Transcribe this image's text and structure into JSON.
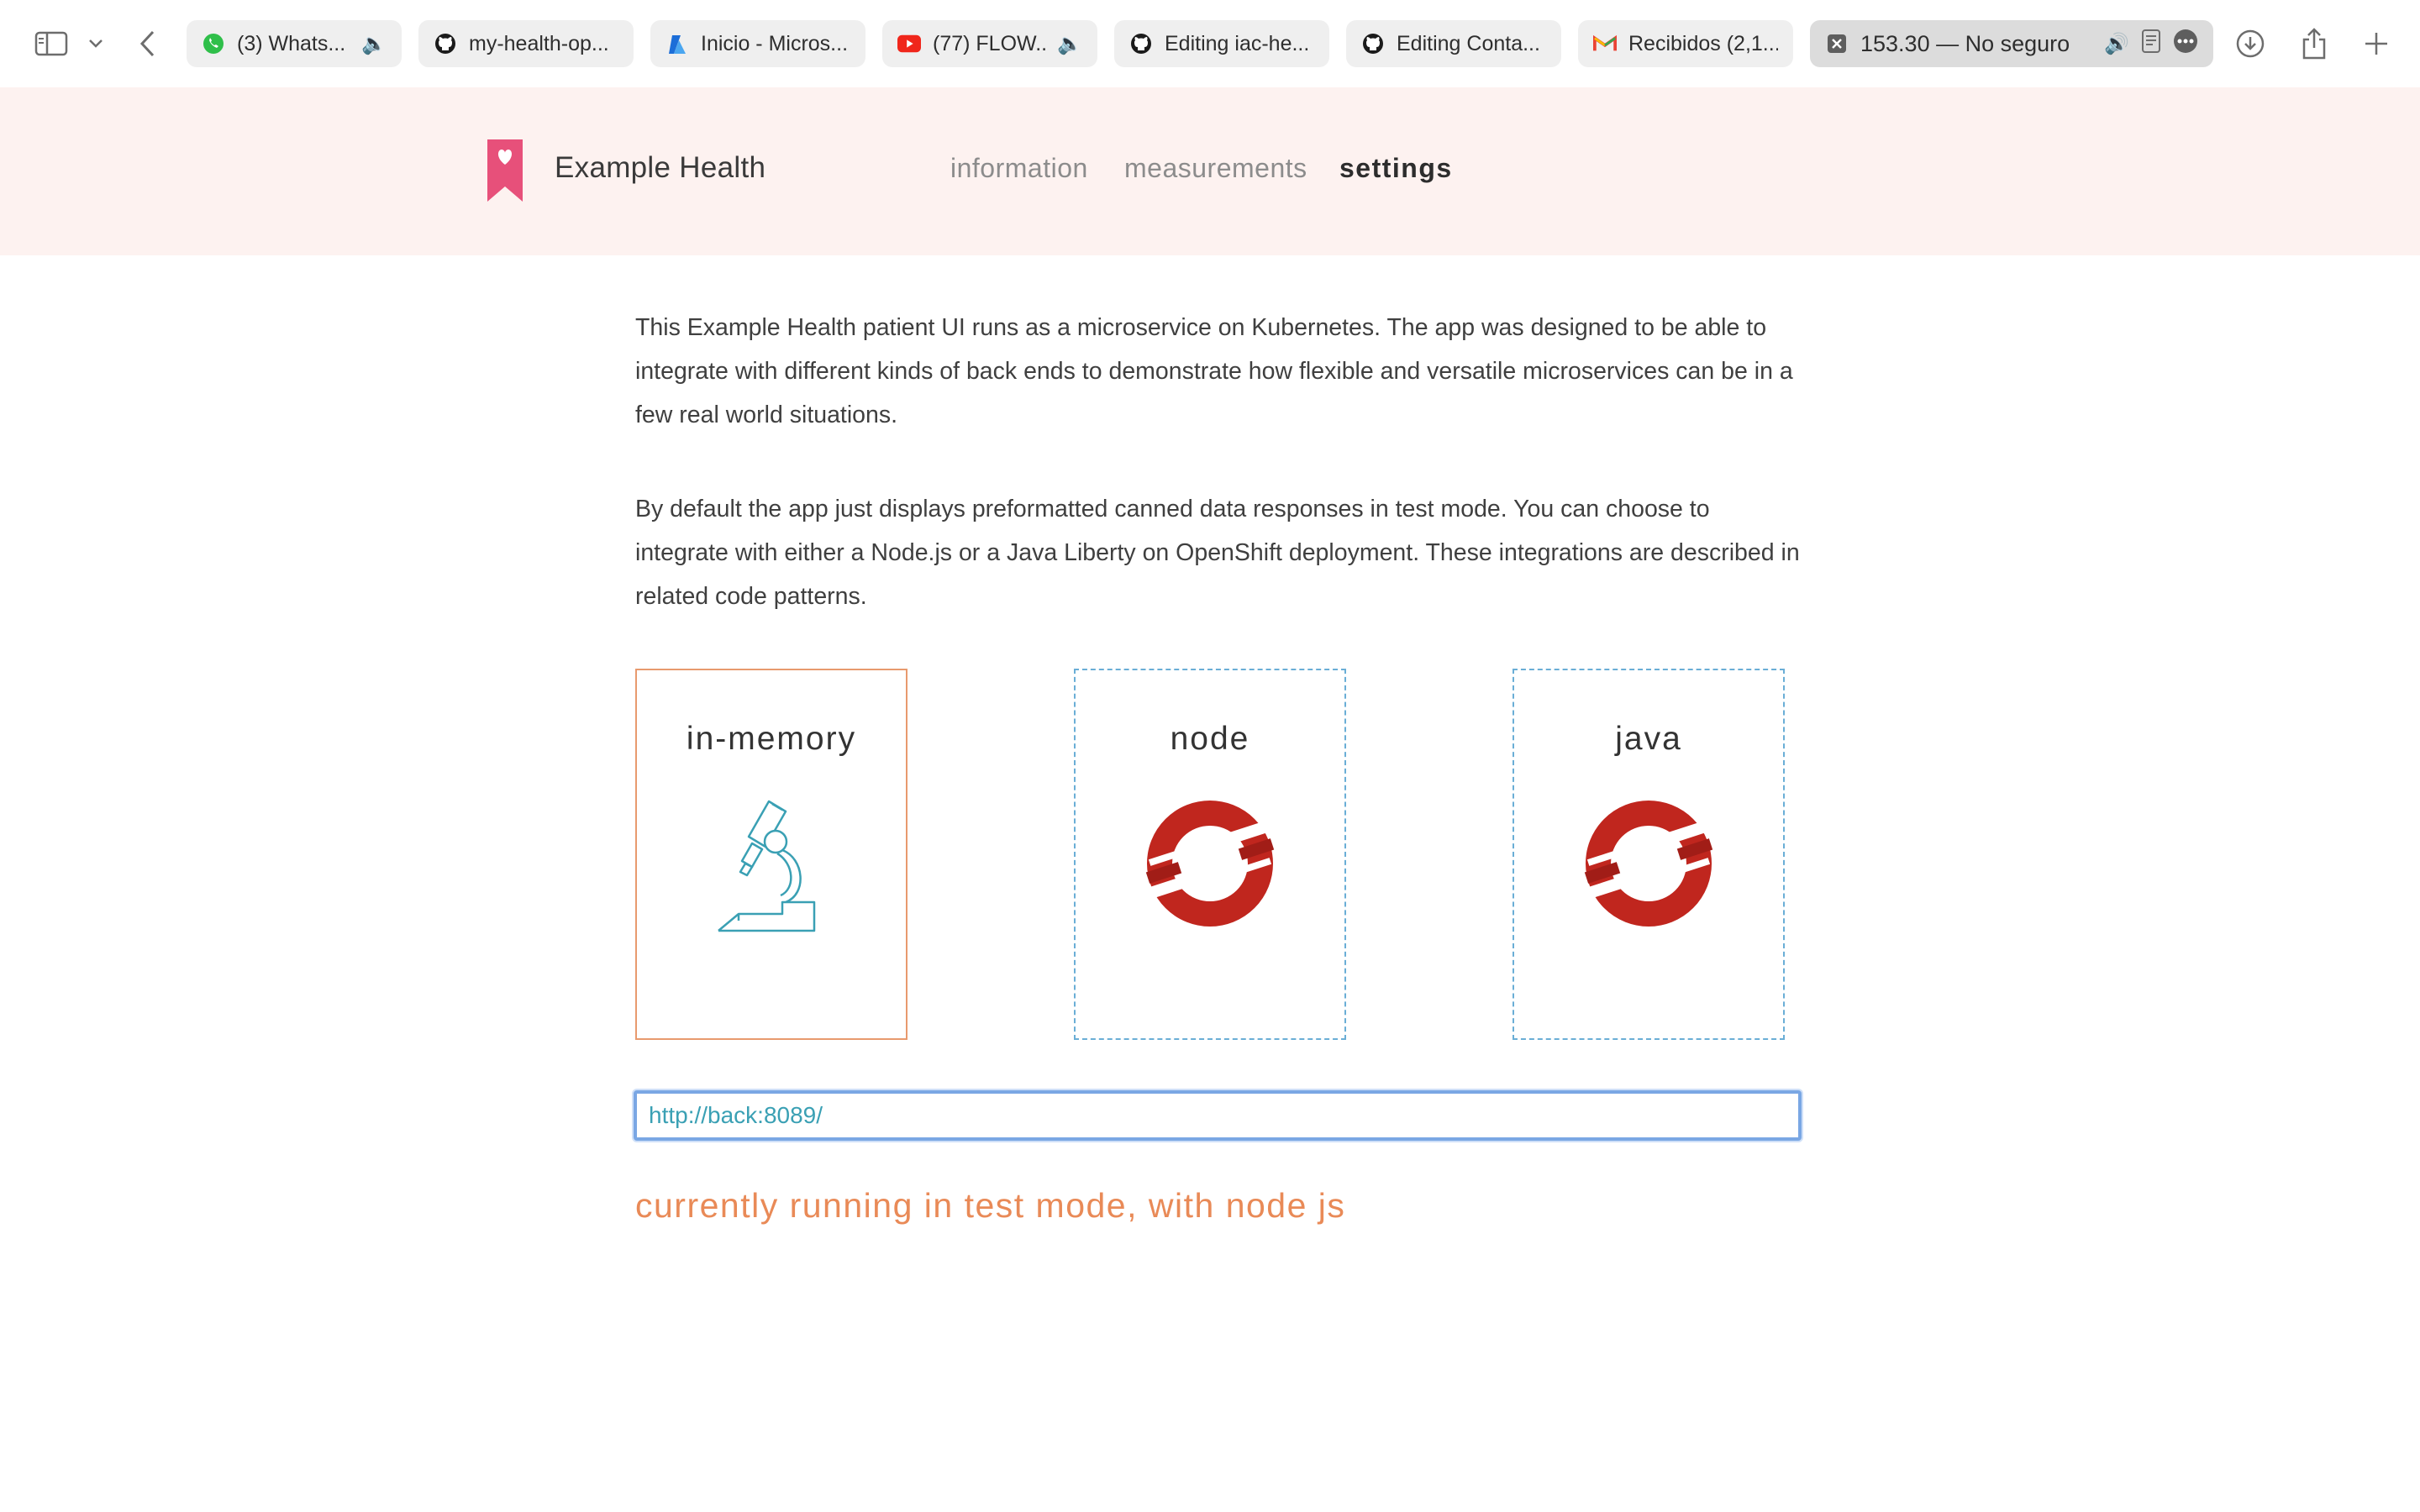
{
  "browser": {
    "tabs": [
      {
        "title": "(3) Whats...",
        "icon": "whatsapp-icon",
        "audio": true
      },
      {
        "title": "my-health-op...",
        "icon": "github-icon",
        "audio": false
      },
      {
        "title": "Inicio - Micros...",
        "icon": "azure-icon",
        "audio": false
      },
      {
        "title": "(77) FLOW...",
        "icon": "youtube-icon",
        "audio": true
      },
      {
        "title": "Editing iac-he...",
        "icon": "github-icon",
        "audio": false
      },
      {
        "title": "Editing Conta...",
        "icon": "github-icon",
        "audio": false
      },
      {
        "title": "Recibidos (2,1...",
        "icon": "gmail-icon",
        "audio": false
      }
    ],
    "active_tab": {
      "title": "153.30 — No seguro"
    }
  },
  "header": {
    "brand": "Example Health",
    "nav": {
      "information": "information",
      "measurements": "measurements",
      "settings": "settings"
    }
  },
  "content": {
    "paragraph1": "This Example Health patient UI runs as a microservice on Kubernetes. The app was designed to be able to integrate with different kinds of back ends to demonstrate how flexible and versatile microservices can be in a few real world situations.",
    "paragraph2": "By default the app just displays preformatted canned data responses in test mode. You can choose to integrate with either a Node.js or a Java Liberty on OpenShift deployment. These integrations are described in related code patterns.",
    "cards": [
      {
        "label": "in-memory",
        "icon": "microscope-icon",
        "selected": true
      },
      {
        "label": "node",
        "icon": "openshift-icon",
        "selected": false
      },
      {
        "label": "java",
        "icon": "openshift-icon",
        "selected": false
      }
    ],
    "endpoint_value": "http://back:8089/",
    "status": "currently running in test mode, with node js"
  },
  "colors": {
    "header_bg": "#fdf2f0",
    "brand_pink": "#e7507a",
    "selected_border": "#e89a6e",
    "dashed_border": "#6aaed6",
    "status_orange": "#e98a57",
    "openshift_red": "#c0261e",
    "microscope_teal": "#3aa0b4"
  }
}
